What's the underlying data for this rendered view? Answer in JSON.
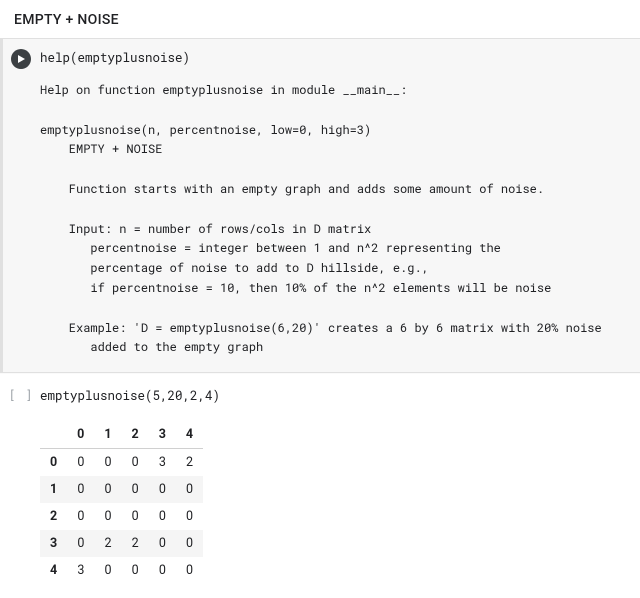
{
  "heading": "EMPTY + NOISE",
  "cells": [
    {
      "status": "executed",
      "icon": "play-filled",
      "code": "help(emptyplusnoise)",
      "output_text": "Help on function emptyplusnoise in module __main__:\n\nemptyplusnoise(n, percentnoise, low=0, high=3)\n    EMPTY + NOISE\n    \n    Function starts with an empty graph and adds some amount of noise.\n    \n    Input: n = number of rows/cols in D matrix\n       percentnoise = integer between 1 and n^2 representing the\n       percentage of noise to add to D hillside, e.g.,\n       if percentnoise = 10, then 10% of the n^2 elements will be noise\n    \n    Example: 'D = emptyplusnoise(6,20)' creates a 6 by 6 matrix with 20% noise\n       added to the empty graph"
    },
    {
      "status": "idle",
      "icon": "bracket",
      "bracket_label": "[ ]",
      "code": "emptyplusnoise(5,20,2,4)",
      "output_table": {
        "columns": [
          "0",
          "1",
          "2",
          "3",
          "4"
        ],
        "index": [
          "0",
          "1",
          "2",
          "3",
          "4"
        ],
        "rows": [
          [
            "0",
            "0",
            "0",
            "3",
            "2"
          ],
          [
            "0",
            "0",
            "0",
            "0",
            "0"
          ],
          [
            "0",
            "0",
            "0",
            "0",
            "0"
          ],
          [
            "0",
            "2",
            "2",
            "0",
            "0"
          ],
          [
            "3",
            "0",
            "0",
            "0",
            "0"
          ]
        ]
      }
    }
  ]
}
